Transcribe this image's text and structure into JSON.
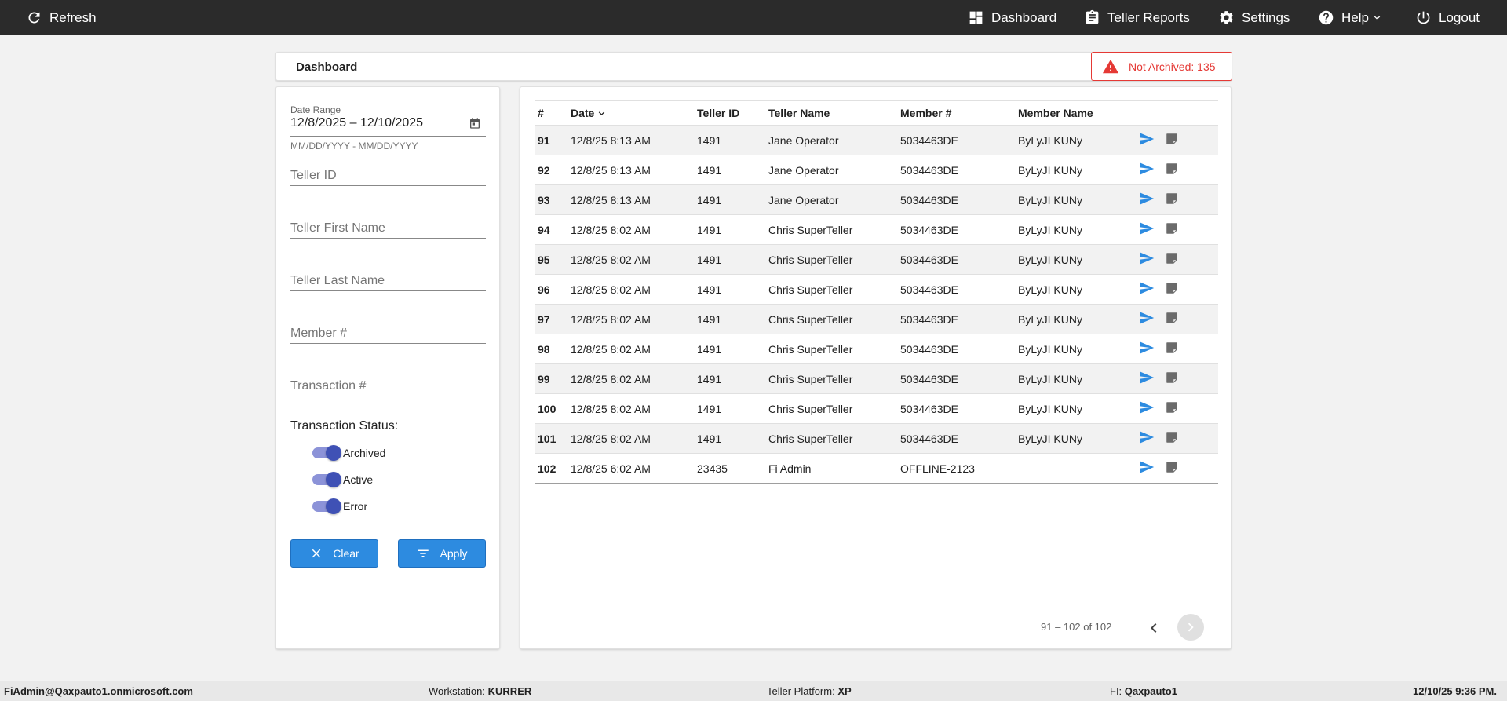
{
  "topbar": {
    "refresh_label": "Refresh",
    "dashboard_label": "Dashboard",
    "teller_reports_label": "Teller Reports",
    "settings_label": "Settings",
    "help_label": "Help",
    "logout_label": "Logout",
    "background": "#2b2b2b"
  },
  "header": {
    "title": "Dashboard",
    "not_archived_label": "Not Archived: 135",
    "alert_color": "#e53935"
  },
  "filters": {
    "date_range_label": "Date Range",
    "date_range_value": "12/8/2025 – 12/10/2025",
    "date_hint": "MM/DD/YYYY - MM/DD/YYYY",
    "teller_id_placeholder": "Teller ID",
    "teller_first_name_placeholder": "Teller First Name",
    "teller_last_name_placeholder": "Teller Last Name",
    "member_placeholder": "Member #",
    "transaction_placeholder": "Transaction #",
    "status_label": "Transaction Status:",
    "statuses": [
      {
        "label": "Archived",
        "on": true
      },
      {
        "label": "Active",
        "on": true
      },
      {
        "label": "Error",
        "on": true
      }
    ],
    "clear_label": "Clear",
    "apply_label": "Apply",
    "button_color": "#2d8be0"
  },
  "table": {
    "columns": [
      "#",
      "Date",
      "Teller ID",
      "Teller Name",
      "Member #",
      "Member Name"
    ],
    "rows": [
      {
        "num": "91",
        "date": "12/8/25 8:13 AM",
        "teller_id": "1491",
        "teller_name": "Jane Operator",
        "member": "5034463DE",
        "member_name": "ByLyJI KUNy"
      },
      {
        "num": "92",
        "date": "12/8/25 8:13 AM",
        "teller_id": "1491",
        "teller_name": "Jane Operator",
        "member": "5034463DE",
        "member_name": "ByLyJI KUNy"
      },
      {
        "num": "93",
        "date": "12/8/25 8:13 AM",
        "teller_id": "1491",
        "teller_name": "Jane Operator",
        "member": "5034463DE",
        "member_name": "ByLyJI KUNy"
      },
      {
        "num": "94",
        "date": "12/8/25 8:02 AM",
        "teller_id": "1491",
        "teller_name": "Chris SuperTeller",
        "member": "5034463DE",
        "member_name": "ByLyJI KUNy"
      },
      {
        "num": "95",
        "date": "12/8/25 8:02 AM",
        "teller_id": "1491",
        "teller_name": "Chris SuperTeller",
        "member": "5034463DE",
        "member_name": "ByLyJI KUNy"
      },
      {
        "num": "96",
        "date": "12/8/25 8:02 AM",
        "teller_id": "1491",
        "teller_name": "Chris SuperTeller",
        "member": "5034463DE",
        "member_name": "ByLyJI KUNy"
      },
      {
        "num": "97",
        "date": "12/8/25 8:02 AM",
        "teller_id": "1491",
        "teller_name": "Chris SuperTeller",
        "member": "5034463DE",
        "member_name": "ByLyJI KUNy"
      },
      {
        "num": "98",
        "date": "12/8/25 8:02 AM",
        "teller_id": "1491",
        "teller_name": "Chris SuperTeller",
        "member": "5034463DE",
        "member_name": "ByLyJI KUNy"
      },
      {
        "num": "99",
        "date": "12/8/25 8:02 AM",
        "teller_id": "1491",
        "teller_name": "Chris SuperTeller",
        "member": "5034463DE",
        "member_name": "ByLyJI KUNy"
      },
      {
        "num": "100",
        "date": "12/8/25 8:02 AM",
        "teller_id": "1491",
        "teller_name": "Chris SuperTeller",
        "member": "5034463DE",
        "member_name": "ByLyJI KUNy"
      },
      {
        "num": "101",
        "date": "12/8/25 8:02 AM",
        "teller_id": "1491",
        "teller_name": "Chris SuperTeller",
        "member": "5034463DE",
        "member_name": "ByLyJI KUNy"
      },
      {
        "num": "102",
        "date": "12/8/25 6:02 AM",
        "teller_id": "23435",
        "teller_name": "Fi Admin",
        "member": "OFFLINE-2123",
        "member_name": ""
      }
    ],
    "row_icons": [
      "send-icon",
      "note-icon"
    ],
    "accent_color": "#2d8be0"
  },
  "pagination": {
    "range_label": "91 – 102 of 102"
  },
  "footer": {
    "user": "FiAdmin@Qaxpauto1.onmicrosoft.com",
    "workstation_label": "Workstation:",
    "workstation_value": "KURRER",
    "platform_label": "Teller Platform:",
    "platform_value": "XP",
    "fi_label": "FI:",
    "fi_value": "Qaxpauto1",
    "datetime": "12/10/25 9:36 PM."
  }
}
